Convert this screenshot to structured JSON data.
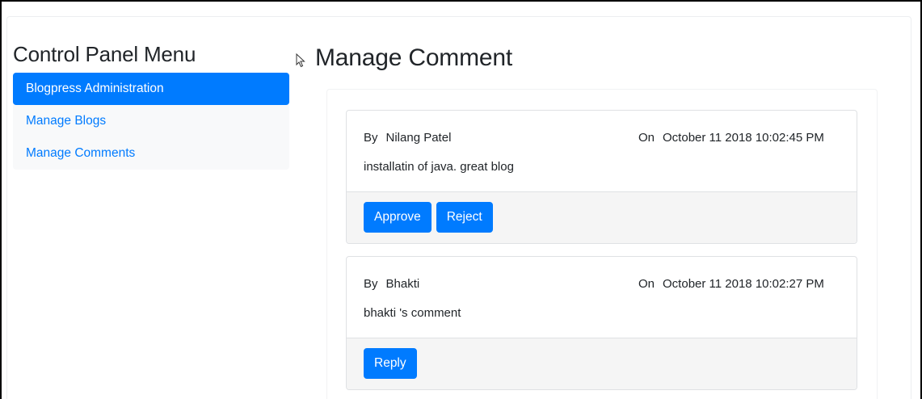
{
  "sidebar": {
    "title": "Control Panel Menu",
    "items": [
      {
        "label": "Blogpress Administration",
        "active": true
      },
      {
        "label": "Manage Blogs",
        "active": false
      },
      {
        "label": "Manage Comments",
        "active": false
      }
    ]
  },
  "main": {
    "title": "Manage Comment",
    "comments": [
      {
        "by_label": "By",
        "author": "Nilang Patel",
        "on_label": "On",
        "date": "October 11 2018 10:02:45 PM",
        "text": "installatin of java. great blog",
        "actions": [
          "Approve",
          "Reject"
        ]
      },
      {
        "by_label": "By",
        "author": "Bhakti",
        "on_label": "On",
        "date": "October 11 2018 10:02:27 PM",
        "text": "bhakti 's comment",
        "actions": [
          "Reply"
        ]
      }
    ]
  },
  "colors": {
    "primary": "#007bff",
    "menu_bg": "#f8f9fa",
    "footer_bg": "#f5f5f5"
  },
  "icons": {
    "cursor": "mouse-pointer-icon"
  }
}
